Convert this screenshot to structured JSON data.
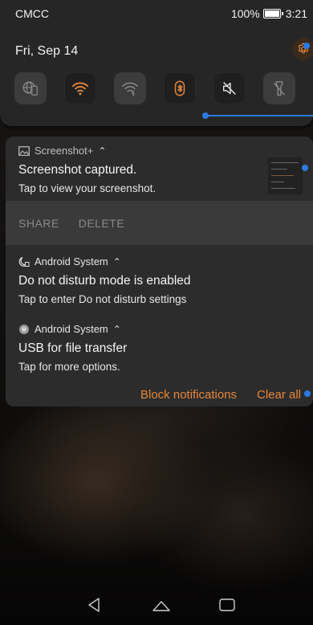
{
  "status_bar": {
    "carrier": "CMCC",
    "battery_percent": "100%",
    "time": "3:21"
  },
  "quick_settings": {
    "date": "Fri, Sep 14",
    "tiles": [
      {
        "icon": "mobile-data-icon",
        "active": false
      },
      {
        "icon": "wifi-icon",
        "active": true
      },
      {
        "icon": "wifi-hotspot-icon",
        "active": false
      },
      {
        "icon": "bluetooth-icon",
        "active": true
      },
      {
        "icon": "sound-off-icon",
        "active": true
      },
      {
        "icon": "flashlight-icon",
        "active": false
      }
    ],
    "accent_color": "#e5873b",
    "handle_color": "#2b7ae4"
  },
  "notifications": {
    "screenshot": {
      "app": "Screenshot+",
      "title": "Screenshot captured.",
      "text": "Tap to view your screenshot.",
      "actions": [
        "SHARE",
        "DELETE"
      ]
    },
    "dnd": {
      "app": "Android System",
      "title": "Do not disturb mode is enabled",
      "text": "Tap to enter Do not disturb settings"
    },
    "usb": {
      "app": "Android System",
      "title": "USB for file transfer",
      "text": "Tap for more options."
    },
    "footer": {
      "block_label": "Block notifications",
      "clear_label": "Clear all"
    }
  },
  "nav_bar": {
    "buttons": [
      "back-icon",
      "home-icon",
      "recents-icon"
    ]
  }
}
